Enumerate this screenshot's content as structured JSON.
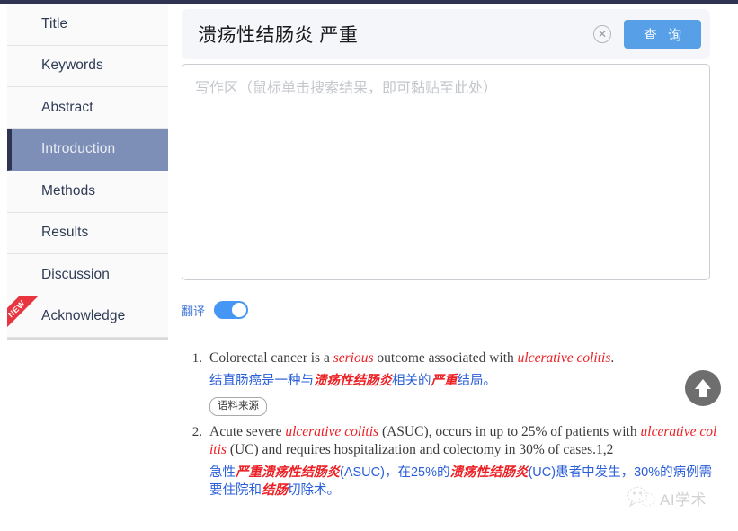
{
  "sidebar": {
    "items": [
      {
        "label": "Title",
        "active": false,
        "badge": null
      },
      {
        "label": "Keywords",
        "active": false,
        "badge": null
      },
      {
        "label": "Abstract",
        "active": false,
        "badge": null
      },
      {
        "label": "Introduction",
        "active": true,
        "badge": null
      },
      {
        "label": "Methods",
        "active": false,
        "badge": null
      },
      {
        "label": "Results",
        "active": false,
        "badge": null
      },
      {
        "label": "Discussion",
        "active": false,
        "badge": null
      },
      {
        "label": "Acknowledge",
        "active": false,
        "badge": "NEW"
      }
    ]
  },
  "search": {
    "value": "溃疡性结肠炎 严重",
    "clear_icon": "close-circle-icon",
    "button_label": "查 询"
  },
  "writing_area": {
    "placeholder": "写作区（鼠标单击搜索结果，即可黏贴至此处）",
    "value": ""
  },
  "translate_toggle": {
    "label": "翻译",
    "state": "on"
  },
  "results": [
    {
      "number": "1.",
      "en_parts": [
        {
          "t": "Colorectal cancer is a ",
          "hl": false
        },
        {
          "t": "serious",
          "hl": true
        },
        {
          "t": " outcome associated with ",
          "hl": false
        },
        {
          "t": "ulcerative colitis",
          "hl": true
        },
        {
          "t": ".",
          "hl": false
        }
      ],
      "zh_parts": [
        {
          "t": "结直肠癌是一种与",
          "hl": false
        },
        {
          "t": "溃疡性结肠炎",
          "hl": true
        },
        {
          "t": "相关的",
          "hl": false
        },
        {
          "t": "严重",
          "hl": true
        },
        {
          "t": "结局。",
          "hl": false
        }
      ],
      "source_label": "语料来源"
    },
    {
      "number": "2.",
      "en_parts": [
        {
          "t": "Acute severe ",
          "hl": false
        },
        {
          "t": "ulcerative colitis",
          "hl": true
        },
        {
          "t": " (ASUC), occurs in up to 25% of patients with ",
          "hl": false
        },
        {
          "t": "ulcerative colitis",
          "hl": true
        },
        {
          "t": " (UC) and requires hospitalization and colectomy in 30% of cases.1,2",
          "hl": false
        }
      ],
      "zh_parts": [
        {
          "t": "急性",
          "hl": false
        },
        {
          "t": "严重溃疡性结肠炎",
          "hl": true
        },
        {
          "t": "(ASUC)，在25%的",
          "hl": false
        },
        {
          "t": "溃疡性结肠炎",
          "hl": true
        },
        {
          "t": "(UC)患者中发生，30%的病例需要住院和",
          "hl": false
        },
        {
          "t": "结肠",
          "hl": true
        },
        {
          "t": "切除术。",
          "hl": false
        }
      ],
      "source_label": null
    }
  ],
  "back_to_top": {
    "icon": "arrow-up-icon"
  },
  "watermark": {
    "icon": "wechat-icon",
    "text": "AI学术"
  },
  "colors": {
    "accent_blue": "#57a0e8",
    "toggle_blue": "#4596f5",
    "sidebar_active": "#7e8fb7",
    "sidebar_active_border": "#2f3550",
    "highlight_red": "#ec2024",
    "translation_blue": "#2a5fd8",
    "ribbon_red": "#e8343f"
  }
}
